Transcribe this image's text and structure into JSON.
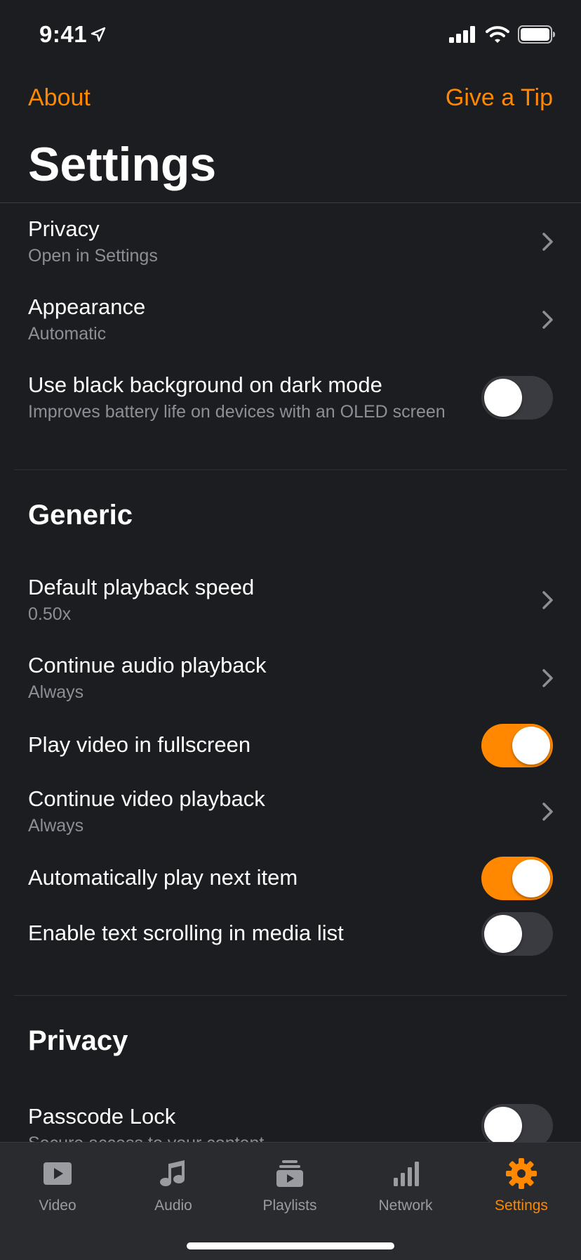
{
  "status_bar": {
    "time": "9:41"
  },
  "nav": {
    "left_link": "About",
    "right_link": "Give a Tip",
    "title": "Settings"
  },
  "rows_top": [
    {
      "title": "Privacy",
      "subtitle": "Open in Settings",
      "accessory": "chevron-right-icon"
    },
    {
      "title": "Appearance",
      "subtitle": "Automatic",
      "accessory": "chevron-right-icon"
    },
    {
      "title": "Use black background on dark mode",
      "subtitle": "Improves battery life on devices with an OLED screen",
      "accessory": "toggle",
      "on": false
    }
  ],
  "generic": {
    "header": "Generic",
    "rows": [
      {
        "title": "Default playback speed",
        "subtitle": "0.50x",
        "accessory": "chevron-right-icon"
      },
      {
        "title": "Continue audio playback",
        "subtitle": "Always",
        "accessory": "chevron-right-icon"
      },
      {
        "title": "Play video in fullscreen",
        "accessory": "toggle",
        "on": true
      },
      {
        "title": "Continue video playback",
        "subtitle": "Always",
        "accessory": "chevron-right-icon"
      },
      {
        "title": "Automatically play next item",
        "accessory": "toggle",
        "on": true
      },
      {
        "title": "Enable text scrolling in media list",
        "accessory": "toggle",
        "on": false
      }
    ]
  },
  "privacy": {
    "header": "Privacy",
    "rows": [
      {
        "title": "Passcode Lock",
        "subtitle": "Secure access to your content",
        "accessory": "toggle",
        "on": false
      }
    ]
  },
  "tab_bar": {
    "tabs": [
      {
        "label": "Video",
        "icon": "video-icon",
        "active": false
      },
      {
        "label": "Audio",
        "icon": "music-note-icon",
        "active": false
      },
      {
        "label": "Playlists",
        "icon": "playlists-icon",
        "active": false
      },
      {
        "label": "Network",
        "icon": "network-bars-icon",
        "active": false
      },
      {
        "label": "Settings",
        "icon": "gear-icon",
        "active": true
      }
    ]
  },
  "colors": {
    "accent": "#ff8800",
    "background": "#1c1d20",
    "secondary_text": "#8d8f96",
    "toggle_off": "#3a3b40",
    "tab_bar": "#2a2b2f"
  }
}
